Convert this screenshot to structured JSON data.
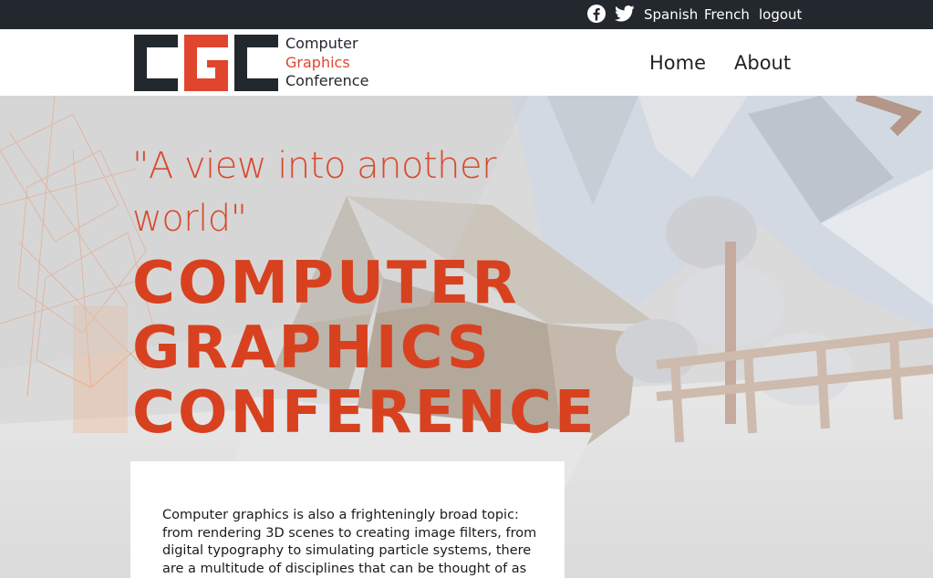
{
  "topbar": {
    "icons": [
      "facebook-icon",
      "twitter-icon"
    ],
    "links": {
      "spanish": "Spanish",
      "french": "French",
      "logout": "logout"
    }
  },
  "header": {
    "logo_mark": "CGC",
    "logo_lines": {
      "line1": "Computer",
      "line2": "Graphics",
      "line3": "Conference"
    },
    "nav": {
      "home": "Home",
      "about": "About"
    }
  },
  "hero": {
    "quote": "\"A view into another world\"",
    "title": "COMPUTER GRAPHICS CONFERENCE",
    "body": "Computer graphics is also a frighteningly broad topic: from rendering 3D scenes to creating image filters, from digital typography to simulating particle systems, there are a multitude of disciplines that can be thought of as part of"
  },
  "colors": {
    "topbar_bg": "#23272e",
    "accent": "#e0452e",
    "title": "#d8411f",
    "text_dark": "#1e2228"
  }
}
